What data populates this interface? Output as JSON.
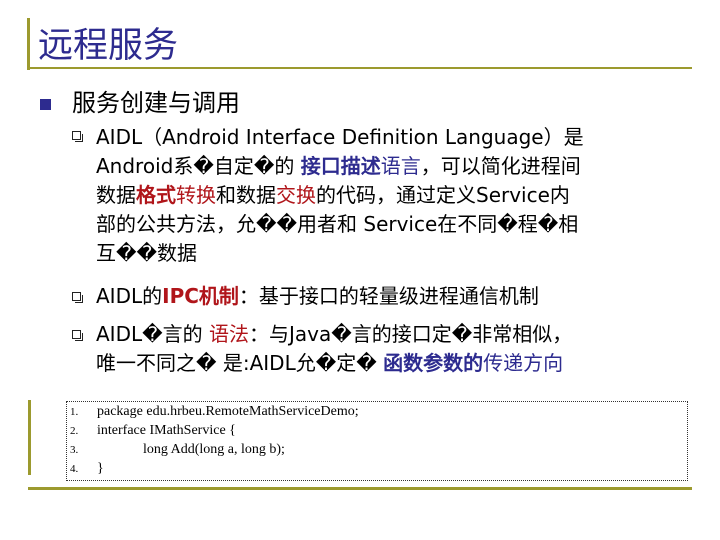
{
  "title": "远程服务",
  "section": {
    "heading": "服务创建与调用",
    "items": [
      {
        "lines": [
          [
            {
              "t": "AIDL（Android Interface Definition Language）是",
              "s": ""
            }
          ],
          [
            {
              "t": "Android系�自定�的 ",
              "s": ""
            },
            {
              "t": "接口描述",
              "s": "blue"
            },
            {
              "t": "语言",
              "s": "bluen"
            },
            {
              "t": "，可以简化进程间",
              "s": ""
            }
          ],
          [
            {
              "t": "数据",
              "s": ""
            },
            {
              "t": "格式",
              "s": "red"
            },
            {
              "t": "转换",
              "s": "redn"
            },
            {
              "t": "和数据",
              "s": ""
            },
            {
              "t": "交换",
              "s": "redn"
            },
            {
              "t": "的代码，通过定义Service内",
              "s": ""
            }
          ],
          [
            {
              "t": "部的公共方法，允��用者和 Service在不同�程�相",
              "s": ""
            }
          ],
          [
            {
              "t": "互��数据",
              "s": ""
            }
          ]
        ]
      },
      {
        "lines": [
          [
            {
              "t": "AIDL的",
              "s": ""
            },
            {
              "t": "IPC机制",
              "s": "red"
            },
            {
              "t": "：基于接口的轻量级进程通信机制",
              "s": ""
            }
          ]
        ]
      },
      {
        "lines": [
          [
            {
              "t": "AIDL�言的 ",
              "s": ""
            },
            {
              "t": "语法",
              "s": "redn"
            },
            {
              "t": "：与Java�言的接口定�非常相似，",
              "s": ""
            }
          ],
          [
            {
              "t": "唯一不同之� 是:AIDL允�定� ",
              "s": ""
            },
            {
              "t": "函数参数的",
              "s": "blue"
            },
            {
              "t": "传递方向",
              "s": "bluen"
            }
          ]
        ]
      }
    ]
  },
  "code": {
    "lines": [
      {
        "num": "1.",
        "text": "package edu.hrbeu.RemoteMathServiceDemo;",
        "indent": false
      },
      {
        "num": "2.",
        "text": "interface IMathService {",
        "indent": false
      },
      {
        "num": "3.",
        "text": "long Add(long a, long b);",
        "indent": true
      },
      {
        "num": "4.",
        "text": "}",
        "indent": false
      }
    ]
  },
  "colors": {
    "accent": "#2d2b8f",
    "highlight_red": "#b0151a",
    "frame": "#9c9a2e"
  }
}
